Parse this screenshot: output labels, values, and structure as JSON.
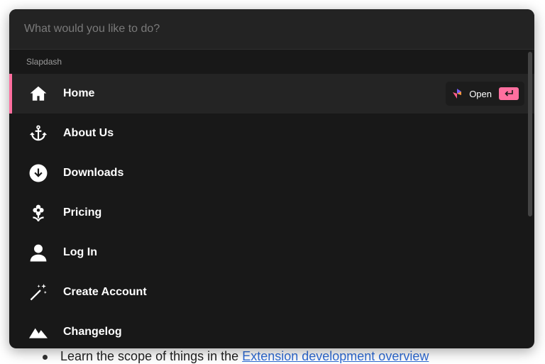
{
  "background": {
    "text_prefix": "Learn the scope of things in the ",
    "link_text": "Extension development overview"
  },
  "search": {
    "placeholder": "What would you like to do?"
  },
  "section_label": "Slapdash",
  "items": [
    {
      "label": "Home",
      "icon": "home-icon",
      "active": true
    },
    {
      "label": "About Us",
      "icon": "anchor-icon"
    },
    {
      "label": "Downloads",
      "icon": "download-circle-icon"
    },
    {
      "label": "Pricing",
      "icon": "flower-icon"
    },
    {
      "label": "Log In",
      "icon": "user-icon"
    },
    {
      "label": "Create Account",
      "icon": "magic-wand-icon"
    },
    {
      "label": "Changelog",
      "icon": "mountain-icon"
    }
  ],
  "action": {
    "label": "Open",
    "key": "enter-key-icon"
  },
  "colors": {
    "accent": "#ff6f9f",
    "panel_bg": "#181818",
    "active_bg": "#242424"
  }
}
